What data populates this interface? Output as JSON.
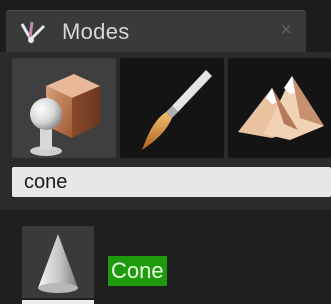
{
  "window": {
    "tab_title": "Modes",
    "close_glyph": "×"
  },
  "mode_tabs": [
    {
      "name": "place-mode",
      "icon": "place-cube-sphere-icon",
      "active": true
    },
    {
      "name": "paint-mode",
      "icon": "paintbrush-icon",
      "active": false
    },
    {
      "name": "landscape-mode",
      "icon": "mountains-icon",
      "active": false
    }
  ],
  "search": {
    "value": "cone",
    "placeholder": ""
  },
  "results": [
    {
      "label": "Cone",
      "icon": "cone-thumbnail-icon"
    }
  ],
  "colors": {
    "highlight": "#1f9a0e",
    "panel": "#2b2b2b",
    "titlebar": "#1d1d1d"
  }
}
